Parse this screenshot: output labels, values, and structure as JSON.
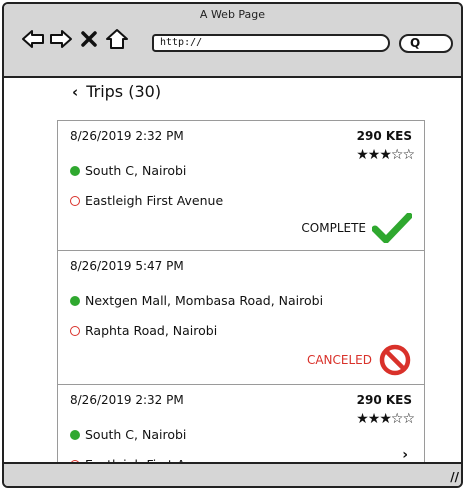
{
  "window": {
    "title": "A Web Page"
  },
  "toolbar": {
    "url": "http://",
    "search_glyph": "Q",
    "icons": [
      "back-icon",
      "forward-icon",
      "close-icon",
      "home-icon",
      "search-icon"
    ]
  },
  "header": {
    "back_glyph": "‹",
    "title": "Trips (30)"
  },
  "trips": [
    {
      "datetime": "8/26/2019 2:32 PM",
      "price": "290 KES",
      "stars": "★★★☆☆",
      "pickup": "South C, Nairobi",
      "dropoff": "Eastleigh First Avenue",
      "status": "COMPLETE"
    },
    {
      "datetime": "8/26/2019 5:47 PM",
      "pickup": "Nextgen Mall, Mombasa Road, Nairobi",
      "dropoff": "Raphta Road, Nairobi",
      "status": "CANCELED"
    },
    {
      "datetime": "8/26/2019 2:32 PM",
      "price": "290 KES",
      "stars": "★★★☆☆",
      "pickup": "South C, Nairobi",
      "dropoff": "Eastleigh First Avenue",
      "more_glyph": "›"
    }
  ],
  "colors": {
    "complete": "#2fa82f",
    "canceled": "#d9312a",
    "chrome": "#d6d6d6"
  }
}
